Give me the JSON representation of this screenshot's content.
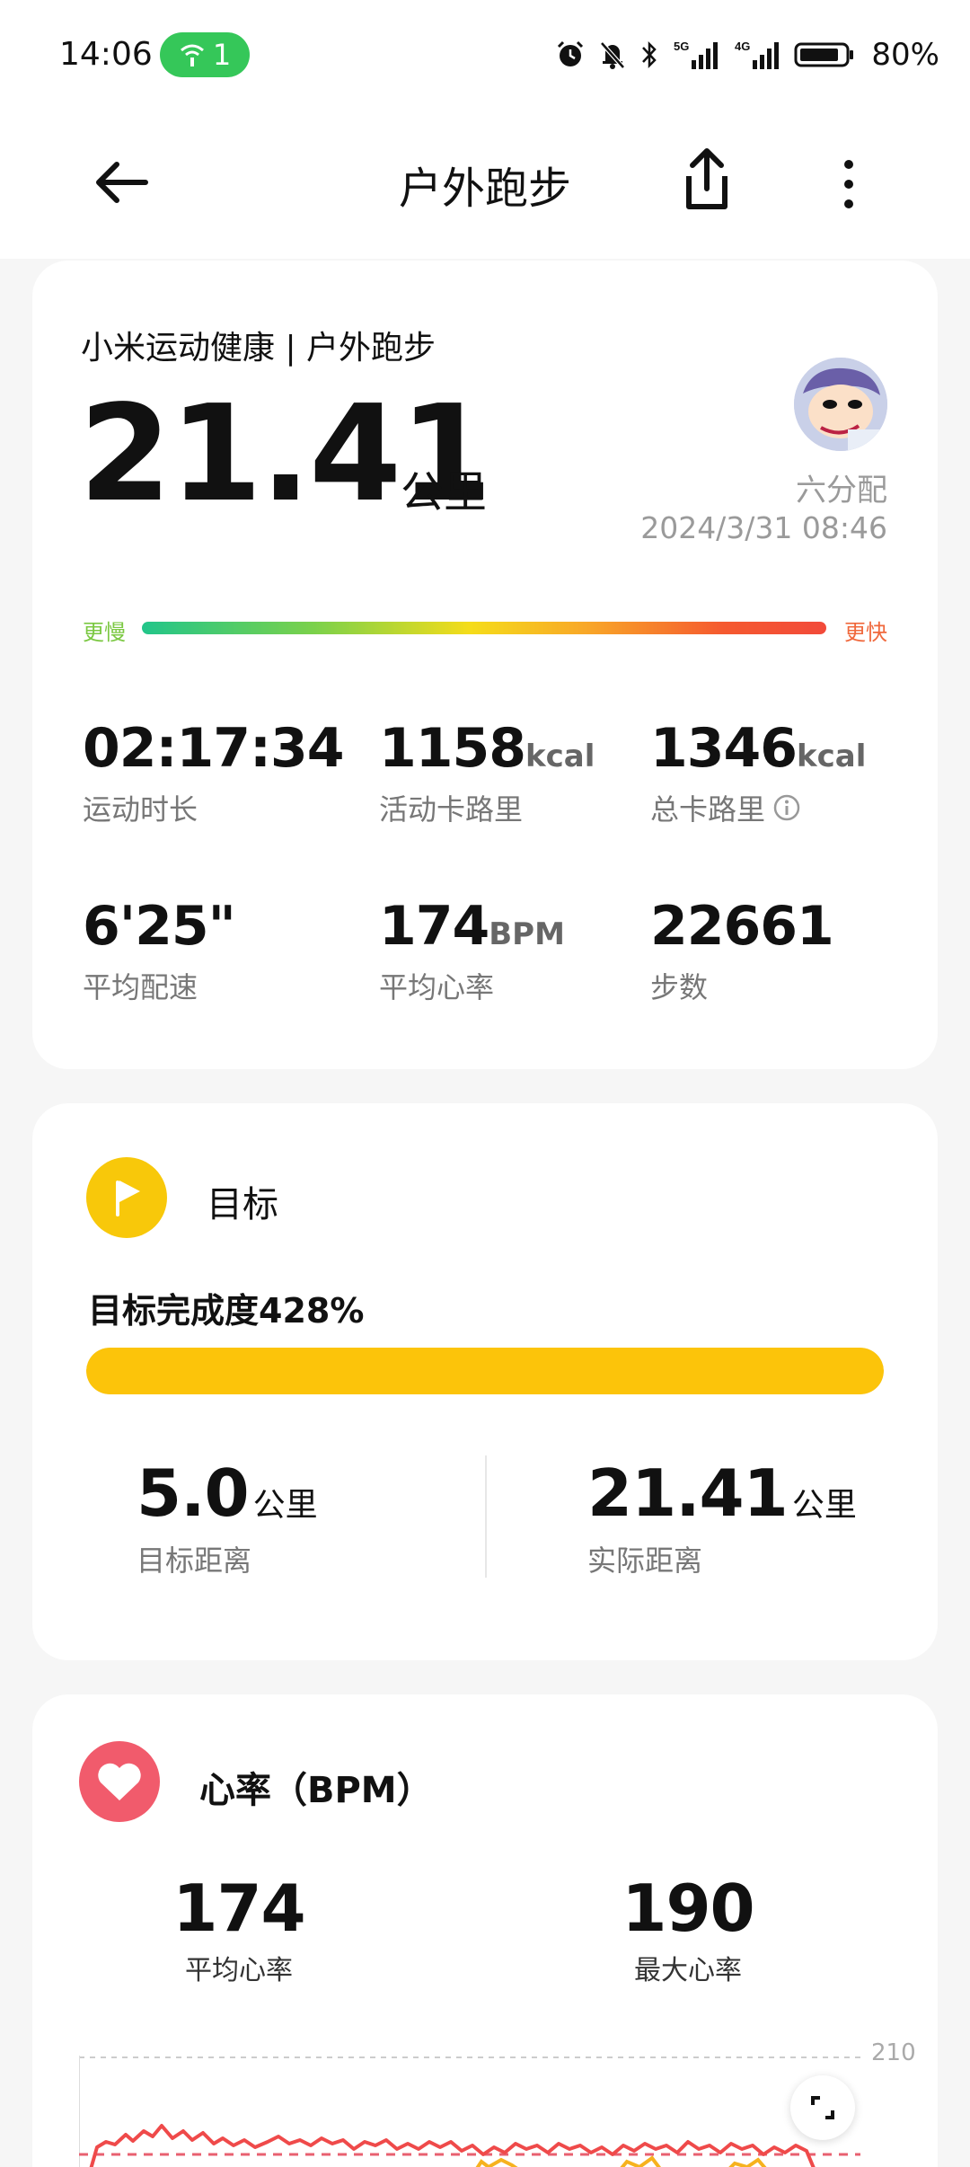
{
  "status_bar": {
    "time": "14:06",
    "hotspot_count": "1",
    "battery": "80%",
    "icons": [
      "alarm-icon",
      "mute-icon",
      "bluetooth-icon",
      "signal-5g-icon",
      "signal-4g-icon",
      "battery-icon"
    ]
  },
  "header": {
    "title": "户外跑步",
    "back_icon": "back-arrow-icon",
    "share_icon": "share-icon",
    "more_icon": "more-vertical-icon"
  },
  "summary": {
    "app_label": "小米运动健康 | 户外跑步",
    "distance": "21.41",
    "distance_unit": "公里",
    "username": "六分配",
    "datetime": "2024/3/31 08:46",
    "pace_slow": "更慢",
    "pace_fast": "更快",
    "stats": [
      {
        "value": "02:17:34",
        "unit": "",
        "label": "运动时长"
      },
      {
        "value": "1158",
        "unit": "kcal",
        "label": "活动卡路里"
      },
      {
        "value": "1346",
        "unit": "kcal",
        "label": "总卡路里"
      },
      {
        "value": "6'25\"",
        "unit": "",
        "label": "平均配速"
      },
      {
        "value": "174",
        "unit": "BPM",
        "label": "平均心率"
      },
      {
        "value": "22661",
        "unit": "",
        "label": "步数"
      }
    ]
  },
  "goal": {
    "title": "目标",
    "completion_text": "目标完成度428%",
    "completion_percent": 428,
    "target_value": "5.0",
    "target_unit": "公里",
    "target_label": "目标距离",
    "actual_value": "21.41",
    "actual_unit": "公里",
    "actual_label": "实际距离"
  },
  "heart_rate": {
    "title": "心率（BPM）",
    "avg_value": "174",
    "avg_label": "平均心率",
    "max_value": "190",
    "max_label": "最大心率",
    "axis_max": "210",
    "accent_color": "#f15b6c"
  },
  "colors": {
    "goal_yellow": "#fcc40a",
    "heart_red": "#f15b6c",
    "hotspot_green": "#35c759"
  }
}
